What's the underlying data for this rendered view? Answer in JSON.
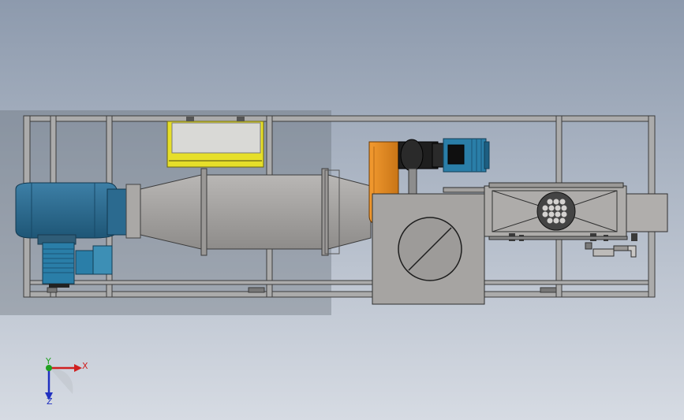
{
  "scene": {
    "background_top": "#8d9aad",
    "background_bottom": "#d6dbe3",
    "frame_color": "#a9a9a9",
    "frame_edge": "#3c3c3c",
    "duct_color": "#a8a6a4",
    "blower_color": "#2d6e94",
    "motor_color": "#2a7ea8",
    "orange_housing": "#e0891f",
    "yellow_box": "#e6df2a"
  },
  "triad": {
    "x_label": "X",
    "y_label": "Y",
    "z_label": "Z",
    "x_color": "#d02020",
    "y_color": "#20a020",
    "z_color": "#2030c0"
  }
}
